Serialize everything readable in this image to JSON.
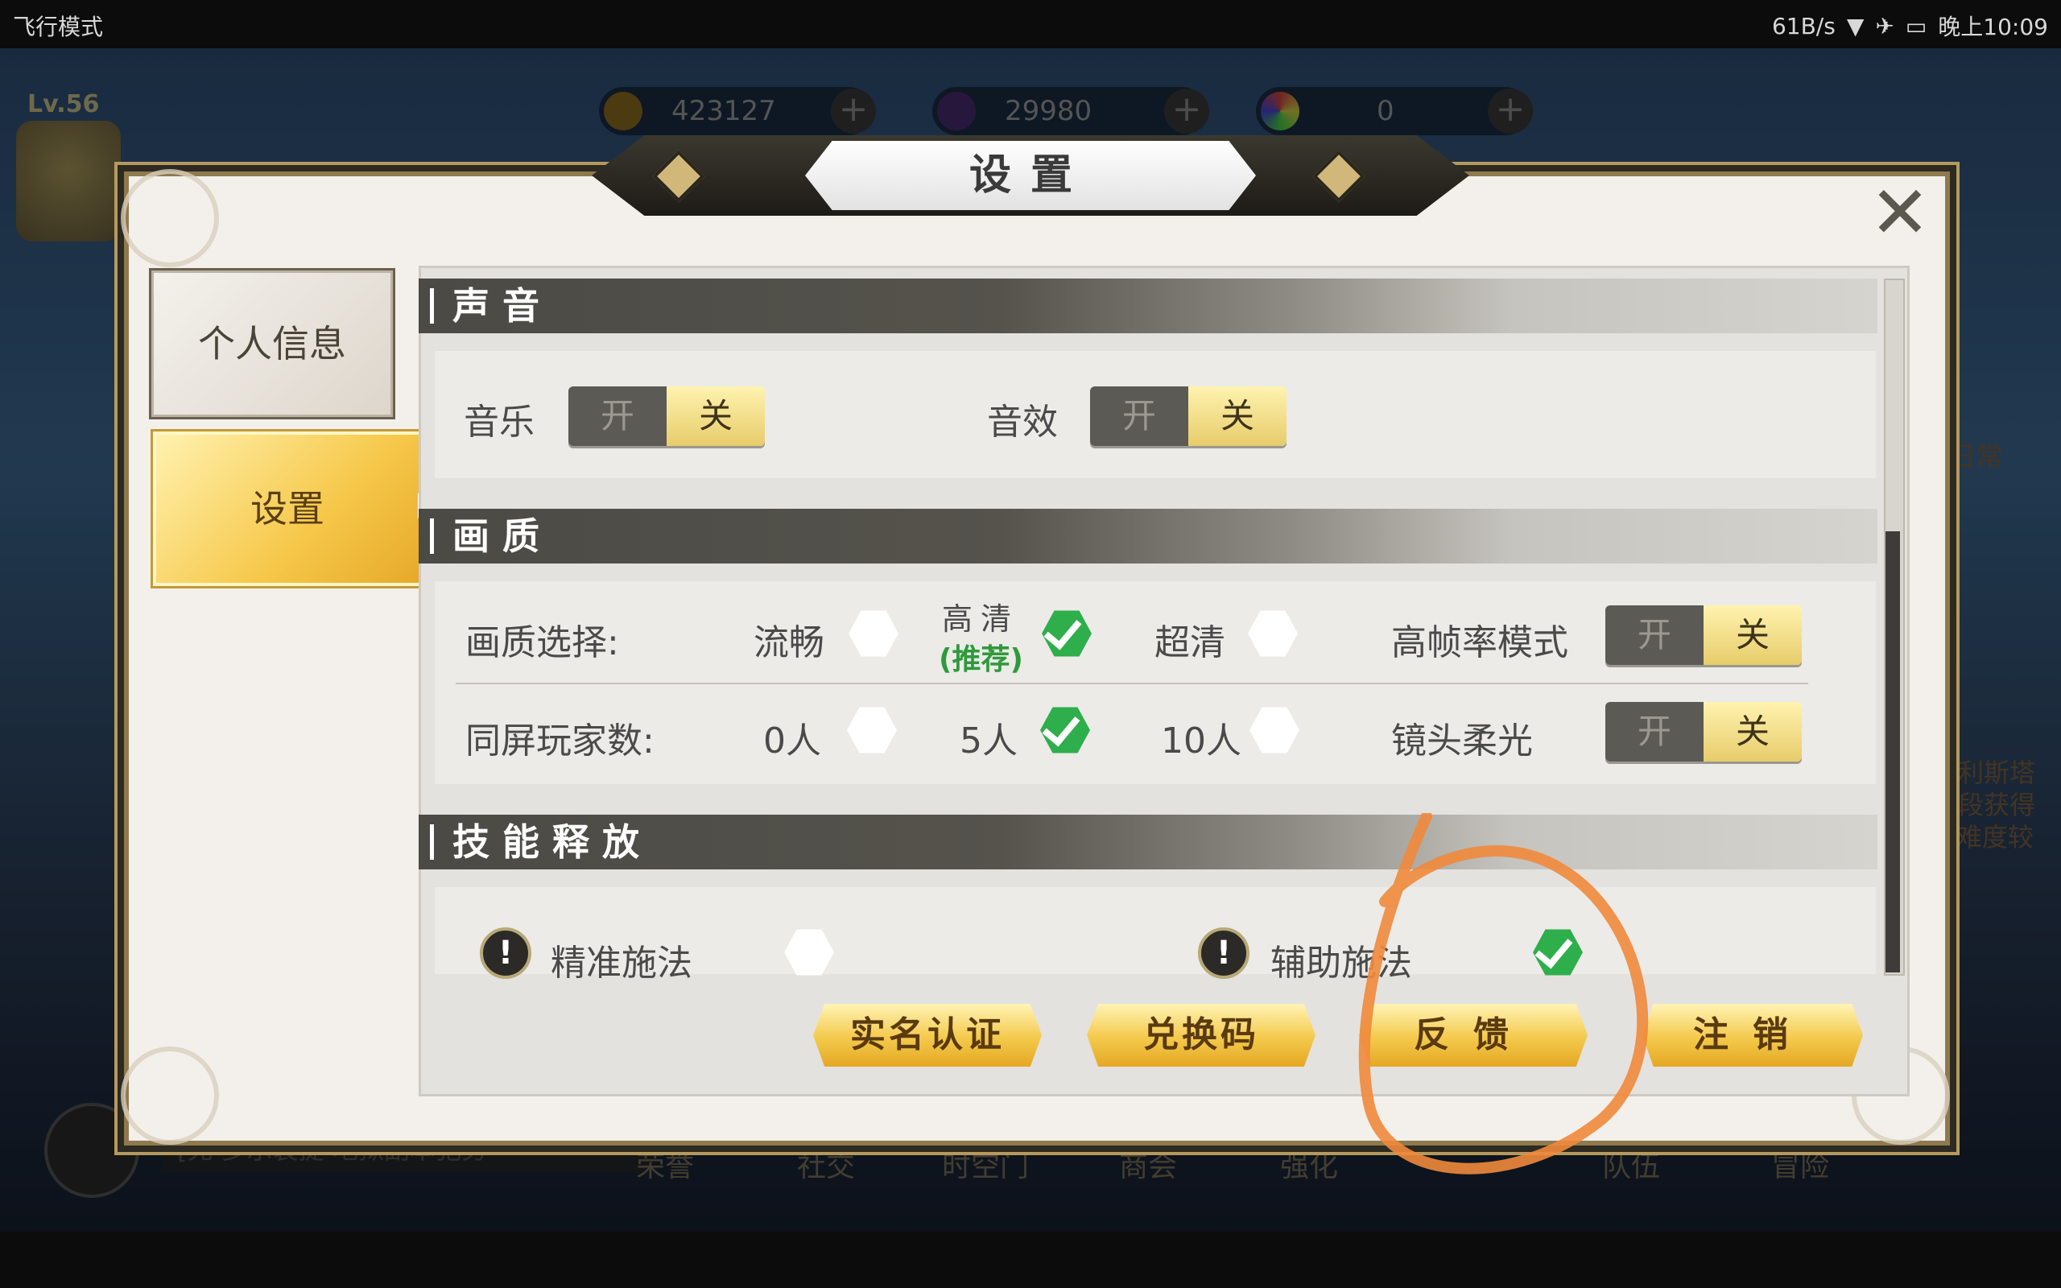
{
  "status_bar": {
    "left_text": "飞行模式",
    "speed": "61B/s",
    "time": "晚上10:09"
  },
  "hud": {
    "level": "Lv.56",
    "resources": [
      {
        "icon": "gold-coin-icon",
        "value": "423127"
      },
      {
        "icon": "purple-gem-icon",
        "value": "29980"
      },
      {
        "icon": "rainbow-orb-icon",
        "value": "0"
      }
    ],
    "bottom_nav": [
      "荣誉",
      "社交",
      "时空门",
      "商会",
      "强化",
      "",
      "队伍",
      "冒险"
    ],
    "chat_preview": "[売 多示装提 地狱副本犯务",
    "side_right": {
      "journal": "日常",
      "text1": "普利斯塔",
      "text2": "手段获得",
      "text3": "难度较"
    }
  },
  "dialog": {
    "title": "设置",
    "tabs": [
      {
        "label": "个人信息",
        "active": false
      },
      {
        "label": "设置",
        "active": true
      }
    ],
    "sections": {
      "sound": {
        "title": "声音",
        "music_label": "音乐",
        "sfx_label": "音效"
      },
      "quality": {
        "title": "画质",
        "quality_select_label": "画质选择:",
        "opt_smooth": "流畅",
        "opt_hd": "高清",
        "opt_hd_note": "(推荐)",
        "opt_uhd": "超清",
        "high_fps_label": "高帧率模式",
        "players_label": "同屏玩家数:",
        "opt_p0": "0人",
        "opt_p5": "5人",
        "opt_p10": "10人",
        "lens_label": "镜头柔光"
      },
      "skill": {
        "title": "技能释放",
        "precise_label": "精准施法",
        "assist_label": "辅助施法"
      }
    },
    "toggle_on": "开",
    "toggle_off": "关",
    "buttons": {
      "real_name": "实名认证",
      "redeem": "兑换码",
      "feedback": "反馈",
      "logout": "注销"
    }
  },
  "colors": {
    "accent_gold": "#f4c94b",
    "check_green": "#2fae4c",
    "annotation_orange": "#f08a3c"
  }
}
